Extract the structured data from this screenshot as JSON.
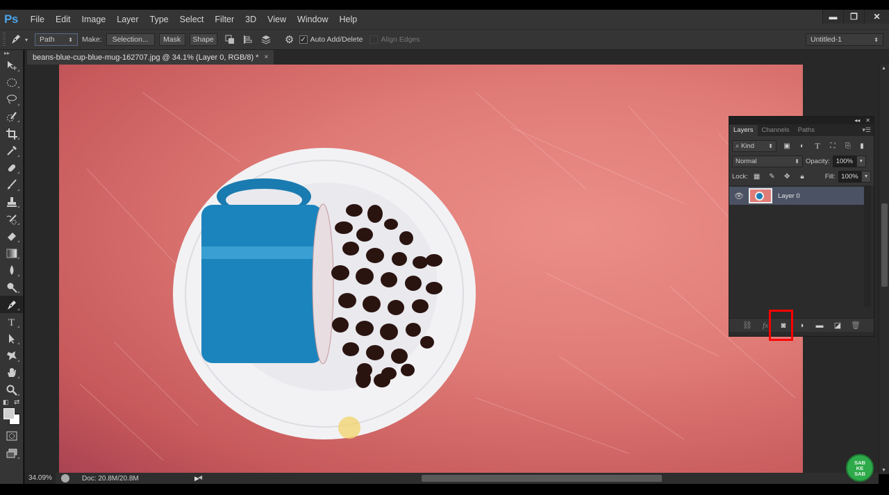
{
  "app": {
    "logo": "Ps",
    "menu": [
      "File",
      "Edit",
      "Image",
      "Layer",
      "Type",
      "Select",
      "Filter",
      "3D",
      "View",
      "Window",
      "Help"
    ],
    "window_controls": {
      "minimize": "minimize-icon",
      "restore": "restore-icon",
      "close": "close-icon"
    }
  },
  "options_bar": {
    "tool_icon": "pen-tool-icon",
    "mode": "Path",
    "make_label": "Make:",
    "selection_btn": "Selection...",
    "mask_btn": "Mask",
    "shape_btn": "Shape",
    "icons": [
      "path-operations-icon",
      "path-alignment-icon",
      "path-arrangement-icon",
      "gear-icon"
    ],
    "auto_add_delete": {
      "label": "Auto Add/Delete",
      "checked": true
    },
    "align_edges": {
      "label": "Align Edges",
      "checked": false,
      "enabled": false
    },
    "workspace": "Untitled-1"
  },
  "document": {
    "tab_title": "beans-blue-cup-blue-mug-162707.jpg @ 34.1% (Layer 0, RGB/8) *",
    "close": "×",
    "image_description": "Blue mug tipped over on white saucer with spilled coffee beans, on red painted wood background"
  },
  "tools": [
    "move-tool",
    "marquee-tool",
    "lasso-tool",
    "quick-selection-tool",
    "crop-tool",
    "eyedropper-tool",
    "healing-brush-tool",
    "brush-tool",
    "clone-stamp-tool",
    "history-brush-tool",
    "eraser-tool",
    "gradient-tool",
    "blur-tool",
    "dodge-tool",
    "pen-tool",
    "type-tool",
    "path-selection-tool",
    "custom-shape-tool",
    "hand-tool",
    "zoom-tool"
  ],
  "active_tool": "pen-tool",
  "colors": {
    "foreground": "#cfcfcf",
    "background": "#ffffff",
    "highlight": "#ff0000",
    "accent": "#4aa3e8"
  },
  "status_bar": {
    "zoom": "34.09%",
    "doc_size": "Doc: 20.8M/20.8M"
  },
  "layers_panel": {
    "tabs": [
      "Layers",
      "Channels",
      "Paths"
    ],
    "active_tab": "Layers",
    "filter_kind": "Kind",
    "blend_mode": "Normal",
    "opacity_label": "Opacity:",
    "opacity": "100%",
    "lock_label": "Lock:",
    "fill_label": "Fill:",
    "fill": "100%",
    "layers": [
      {
        "name": "Layer 0",
        "visible": true,
        "selected": true
      }
    ],
    "bottom_icons": [
      "link-layers-icon",
      "fx-icon",
      "add-layer-mask-icon",
      "adjustment-layer-icon",
      "new-group-icon",
      "new-layer-icon",
      "trash-icon"
    ],
    "highlighted_button": "add-layer-mask-icon",
    "fx_label": "fx"
  },
  "watermark": {
    "lines": [
      "SAB",
      "KE",
      "SAB"
    ]
  }
}
